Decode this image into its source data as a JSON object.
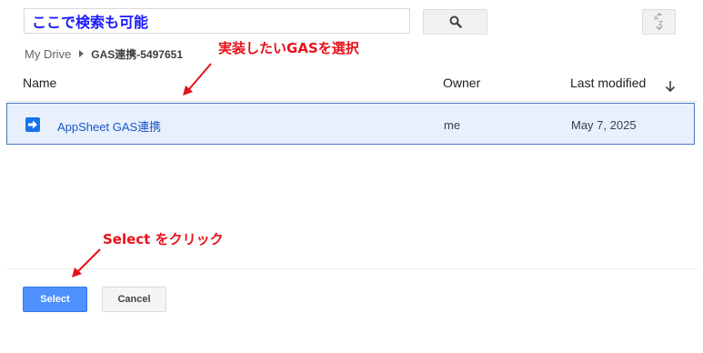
{
  "search": {
    "value": "ここで検索も可能",
    "placeholder": ""
  },
  "breadcrumb": {
    "root": "My Drive",
    "current": "GAS連携-5497651"
  },
  "annotations": {
    "select_gas": "実装したいGASを選択",
    "click_select": "Select をクリック"
  },
  "table": {
    "headers": {
      "name": "Name",
      "owner": "Owner",
      "last_modified": "Last modified"
    },
    "rows": [
      {
        "name": "AppSheet GAS連携",
        "owner": "me",
        "last_modified": "May 7, 2025",
        "icon": "apps-script-icon",
        "selected": true
      }
    ]
  },
  "footer": {
    "select_label": "Select",
    "cancel_label": "Cancel"
  },
  "colors": {
    "accent": "#4d90fe",
    "selection_bg": "#e8f0fe",
    "annotation_red": "#e8101a",
    "search_text": "#1a1aff"
  },
  "icons": [
    "search-icon",
    "sort-az-icon",
    "breadcrumb-chevron-icon",
    "sort-down-arrow-icon",
    "apps-script-icon"
  ]
}
